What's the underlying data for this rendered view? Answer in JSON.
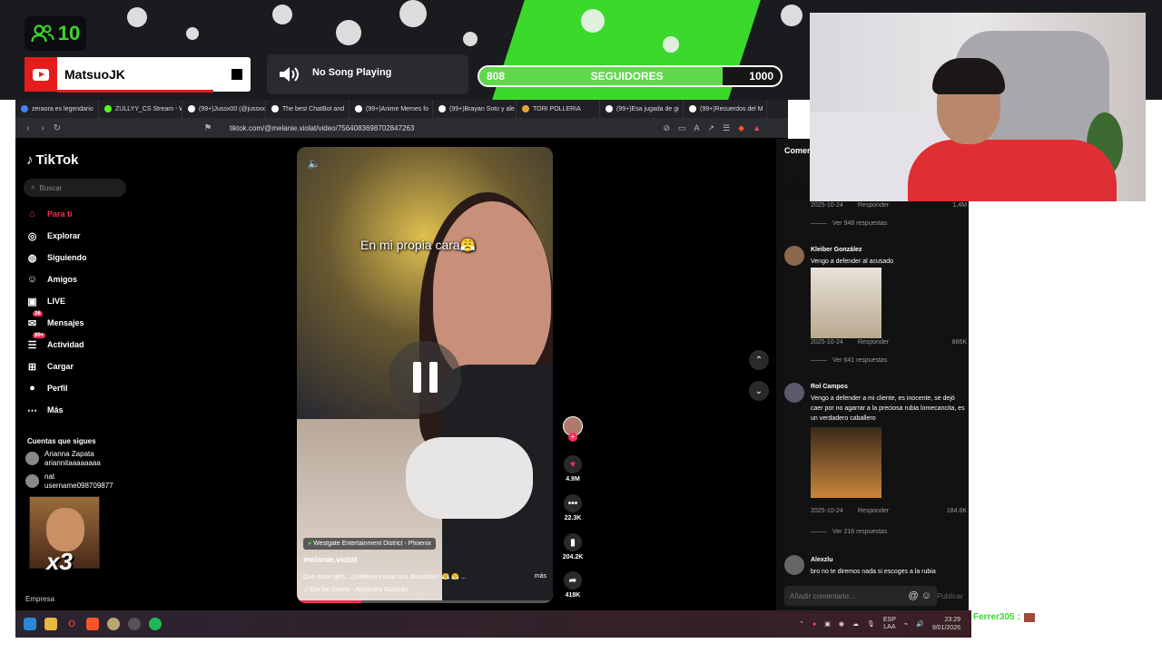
{
  "overlay": {
    "viewer_count": "10",
    "youtube_channel": "MatsuoJK",
    "song_status": "No Song Playing",
    "followers": {
      "current": "808",
      "label": "SEGUIDORES",
      "goal": "1000",
      "progress": 0.808
    },
    "colors": {
      "accent_green": "#3ad92b",
      "youtube_red": "#e51c1c"
    }
  },
  "browser": {
    "tabs": [
      {
        "label": "zeraora es legendario",
        "icon": "google-icon",
        "color": "#4285f4"
      },
      {
        "label": "ZULLYY_CS Stream - W",
        "icon": "kick-icon",
        "color": "#53fc18"
      },
      {
        "label": "(99+)Jussx00 (@jussxx",
        "icon": "tiktok-icon",
        "color": "#ffffff"
      },
      {
        "label": "The best ChatBot and",
        "icon": "ai-icon",
        "color": "#ffffff"
      },
      {
        "label": "(99+)Anime Memes fo",
        "icon": "tiktok-icon",
        "color": "#ffffff"
      },
      {
        "label": "(99+)Brayan Soto y ale",
        "icon": "tiktok-icon",
        "color": "#ffffff"
      },
      {
        "label": "TORI POLLERIA",
        "icon": "web-icon",
        "color": "#e8a33a"
      },
      {
        "label": "(99+)Esa jugada de gi",
        "icon": "tiktok-icon",
        "color": "#ffffff"
      },
      {
        "label": "(99+)Recuerdos del M",
        "icon": "tiktok-icon",
        "color": "#ffffff"
      }
    ],
    "url": "tiktok.com/@melanie.violat/video/7564083698702847263"
  },
  "tiktok": {
    "logo": "TikTok",
    "search_placeholder": "Buscar",
    "nav": [
      {
        "label": "Para ti",
        "icon": "home-icon",
        "active": true
      },
      {
        "label": "Explorar",
        "icon": "compass-icon",
        "active": false
      },
      {
        "label": "Siguiendo",
        "icon": "following-icon",
        "active": false
      },
      {
        "label": "Amigos",
        "icon": "friends-icon",
        "active": false
      },
      {
        "label": "LIVE",
        "icon": "live-icon",
        "active": false
      },
      {
        "label": "Mensajes",
        "icon": "messages-icon",
        "active": false,
        "badge": "36"
      },
      {
        "label": "Actividad",
        "icon": "activity-icon",
        "active": false,
        "badge": "99+"
      },
      {
        "label": "Cargar",
        "icon": "upload-icon",
        "active": false
      },
      {
        "label": "Perfil",
        "icon": "profile-icon",
        "active": false
      },
      {
        "label": "Más",
        "icon": "more-icon",
        "active": false
      }
    ],
    "following_title": "Cuentas que sigues",
    "following": [
      {
        "name": "Arianna Zapata",
        "handle": "ariannitaaaaaaaa"
      },
      {
        "name": "nat",
        "handle": "username098709877"
      }
    ],
    "meme_overlay_text": "x3",
    "footer": "Empresa",
    "video": {
      "caption": "En mi propia cara😤",
      "location": "Westgate Entertainment District - Phoenix",
      "username": "melanie.violat",
      "description": "Que dicen girls...¿Debería iniciar una discusión? 😤 😤 ...",
      "more": "más",
      "song": "Día De Suerte - Alejandra Guzmán",
      "progress": 0.25
    },
    "actions": {
      "likes": "4.9M",
      "comments": "22.3K",
      "saves": "204.2K",
      "shares": "418K"
    }
  },
  "comments": {
    "header": "Comentarios",
    "items": [
      {
        "date": "2025-10-24",
        "reply": "Responder",
        "likes": "1.4M",
        "replies": "Ver 948 respuestas"
      },
      {
        "author": "Kleiber González",
        "text": "Vengo a defender al acusado",
        "date": "2025-10-24",
        "reply": "Responder",
        "likes": "866K",
        "replies": "Ver 641 respuestas"
      },
      {
        "author": "Rol Campos",
        "text": "Vengo a defender a mi cliente, es inocente, se dejó caer por no agarrar a la preciosa rubia lomecancita, es un verdadero caballero",
        "date": "2025-10-24",
        "reply": "Responder",
        "likes": "184.6K",
        "replies": "Ver 216 respuestas"
      },
      {
        "author": "Alexzlu",
        "text": "bro no te diremos nada si escoges a la rubia"
      }
    ],
    "input_placeholder": "Añadir comentario...",
    "publish": "Publicar"
  },
  "taskbar": {
    "lang_top": "ESP",
    "lang_bottom": "LAA",
    "time": "23:29",
    "date": "9/01/2026"
  },
  "chat": {
    "user": "Ferrer305 :"
  }
}
